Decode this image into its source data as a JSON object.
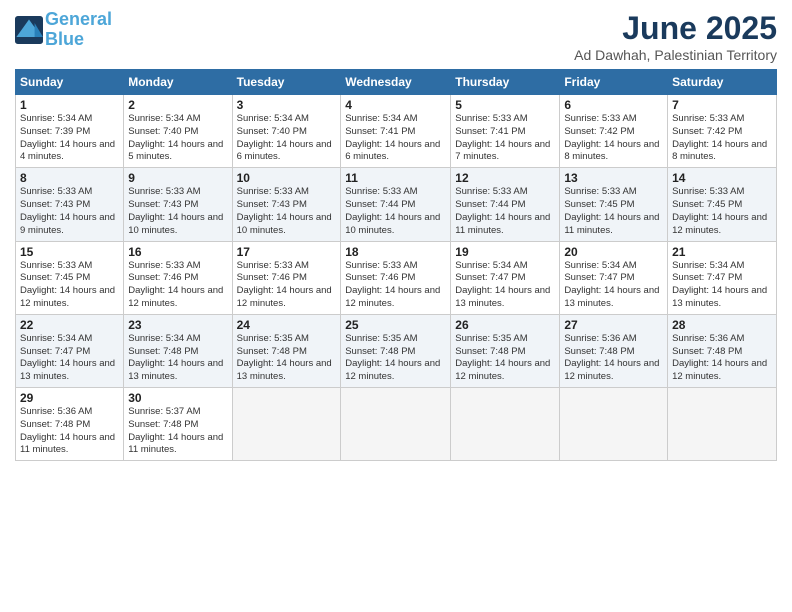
{
  "header": {
    "logo_line1": "General",
    "logo_line2": "Blue",
    "month_title": "June 2025",
    "location": "Ad Dawhah, Palestinian Territory"
  },
  "days_of_week": [
    "Sunday",
    "Monday",
    "Tuesday",
    "Wednesday",
    "Thursday",
    "Friday",
    "Saturday"
  ],
  "weeks": [
    [
      {
        "day": 1,
        "sunrise": "5:34 AM",
        "sunset": "7:39 PM",
        "daylight": "14 hours and 4 minutes."
      },
      {
        "day": 2,
        "sunrise": "5:34 AM",
        "sunset": "7:40 PM",
        "daylight": "14 hours and 5 minutes."
      },
      {
        "day": 3,
        "sunrise": "5:34 AM",
        "sunset": "7:40 PM",
        "daylight": "14 hours and 6 minutes."
      },
      {
        "day": 4,
        "sunrise": "5:34 AM",
        "sunset": "7:41 PM",
        "daylight": "14 hours and 6 minutes."
      },
      {
        "day": 5,
        "sunrise": "5:33 AM",
        "sunset": "7:41 PM",
        "daylight": "14 hours and 7 minutes."
      },
      {
        "day": 6,
        "sunrise": "5:33 AM",
        "sunset": "7:42 PM",
        "daylight": "14 hours and 8 minutes."
      },
      {
        "day": 7,
        "sunrise": "5:33 AM",
        "sunset": "7:42 PM",
        "daylight": "14 hours and 8 minutes."
      }
    ],
    [
      {
        "day": 8,
        "sunrise": "5:33 AM",
        "sunset": "7:43 PM",
        "daylight": "14 hours and 9 minutes."
      },
      {
        "day": 9,
        "sunrise": "5:33 AM",
        "sunset": "7:43 PM",
        "daylight": "14 hours and 10 minutes."
      },
      {
        "day": 10,
        "sunrise": "5:33 AM",
        "sunset": "7:43 PM",
        "daylight": "14 hours and 10 minutes."
      },
      {
        "day": 11,
        "sunrise": "5:33 AM",
        "sunset": "7:44 PM",
        "daylight": "14 hours and 10 minutes."
      },
      {
        "day": 12,
        "sunrise": "5:33 AM",
        "sunset": "7:44 PM",
        "daylight": "14 hours and 11 minutes."
      },
      {
        "day": 13,
        "sunrise": "5:33 AM",
        "sunset": "7:45 PM",
        "daylight": "14 hours and 11 minutes."
      },
      {
        "day": 14,
        "sunrise": "5:33 AM",
        "sunset": "7:45 PM",
        "daylight": "14 hours and 12 minutes."
      }
    ],
    [
      {
        "day": 15,
        "sunrise": "5:33 AM",
        "sunset": "7:45 PM",
        "daylight": "14 hours and 12 minutes."
      },
      {
        "day": 16,
        "sunrise": "5:33 AM",
        "sunset": "7:46 PM",
        "daylight": "14 hours and 12 minutes."
      },
      {
        "day": 17,
        "sunrise": "5:33 AM",
        "sunset": "7:46 PM",
        "daylight": "14 hours and 12 minutes."
      },
      {
        "day": 18,
        "sunrise": "5:33 AM",
        "sunset": "7:46 PM",
        "daylight": "14 hours and 12 minutes."
      },
      {
        "day": 19,
        "sunrise": "5:34 AM",
        "sunset": "7:47 PM",
        "daylight": "14 hours and 13 minutes."
      },
      {
        "day": 20,
        "sunrise": "5:34 AM",
        "sunset": "7:47 PM",
        "daylight": "14 hours and 13 minutes."
      },
      {
        "day": 21,
        "sunrise": "5:34 AM",
        "sunset": "7:47 PM",
        "daylight": "14 hours and 13 minutes."
      }
    ],
    [
      {
        "day": 22,
        "sunrise": "5:34 AM",
        "sunset": "7:47 PM",
        "daylight": "14 hours and 13 minutes."
      },
      {
        "day": 23,
        "sunrise": "5:34 AM",
        "sunset": "7:48 PM",
        "daylight": "14 hours and 13 minutes."
      },
      {
        "day": 24,
        "sunrise": "5:35 AM",
        "sunset": "7:48 PM",
        "daylight": "14 hours and 13 minutes."
      },
      {
        "day": 25,
        "sunrise": "5:35 AM",
        "sunset": "7:48 PM",
        "daylight": "14 hours and 12 minutes."
      },
      {
        "day": 26,
        "sunrise": "5:35 AM",
        "sunset": "7:48 PM",
        "daylight": "14 hours and 12 minutes."
      },
      {
        "day": 27,
        "sunrise": "5:36 AM",
        "sunset": "7:48 PM",
        "daylight": "14 hours and 12 minutes."
      },
      {
        "day": 28,
        "sunrise": "5:36 AM",
        "sunset": "7:48 PM",
        "daylight": "14 hours and 12 minutes."
      }
    ],
    [
      {
        "day": 29,
        "sunrise": "5:36 AM",
        "sunset": "7:48 PM",
        "daylight": "14 hours and 11 minutes."
      },
      {
        "day": 30,
        "sunrise": "5:37 AM",
        "sunset": "7:48 PM",
        "daylight": "14 hours and 11 minutes."
      },
      null,
      null,
      null,
      null,
      null
    ]
  ]
}
